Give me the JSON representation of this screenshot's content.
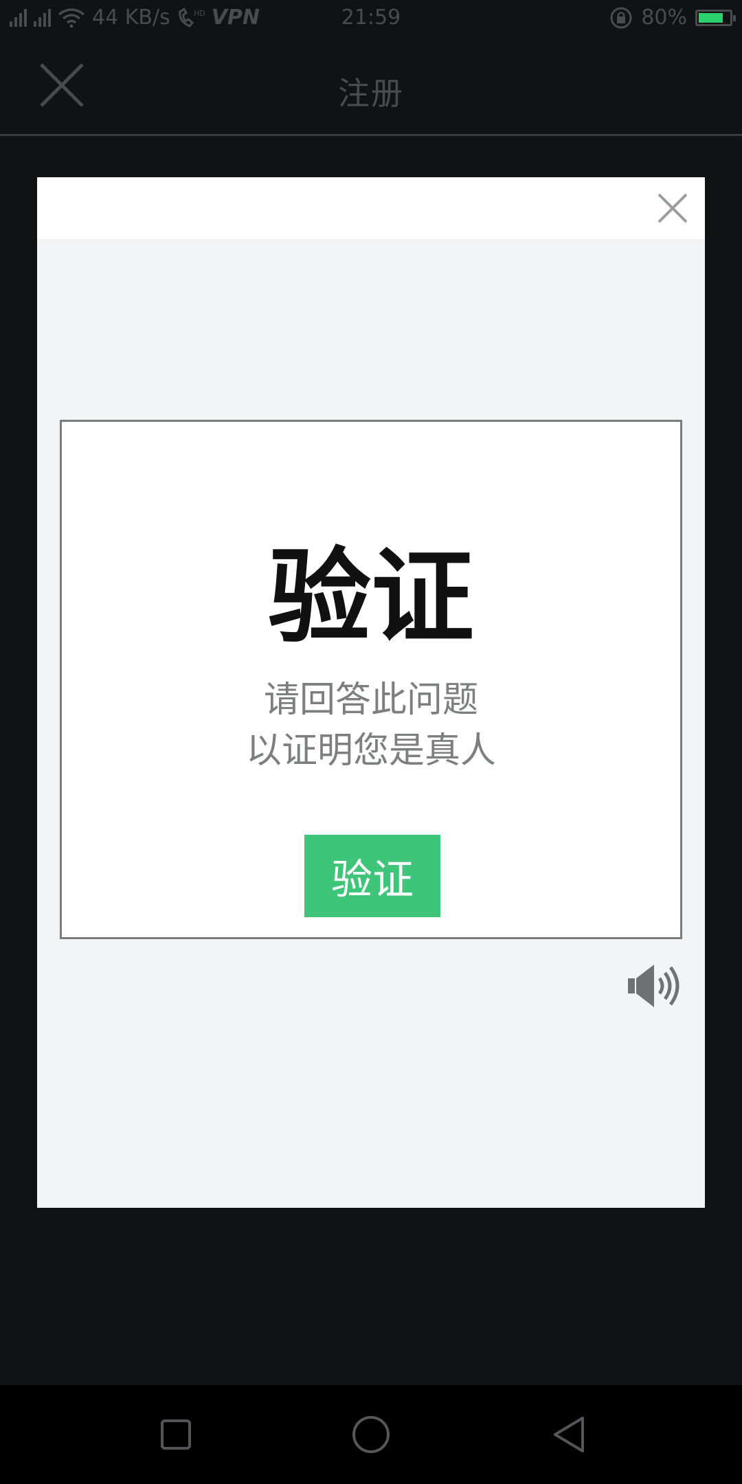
{
  "status_bar": {
    "network_speed": "44 KB/s",
    "vpn_label": "VPN",
    "time": "21:59",
    "battery_percent": "80%",
    "battery_level": 0.8,
    "icons": [
      "signal-icon",
      "wifi-icon",
      "hd-call-icon",
      "rotation-lock-icon",
      "battery-icon"
    ]
  },
  "header": {
    "title": "注册",
    "close_icon": "close-icon"
  },
  "captcha": {
    "close_icon": "close-icon",
    "title": "验证",
    "subtitle_line1": "请回答此问题",
    "subtitle_line2": "以证明您是真人",
    "verify_button_label": "验证",
    "verify_button_color": "#3fc57a",
    "audio_icon": "speaker-icon"
  },
  "nav_bar": {
    "icons": [
      "recent-apps-icon",
      "home-icon",
      "back-icon"
    ]
  }
}
